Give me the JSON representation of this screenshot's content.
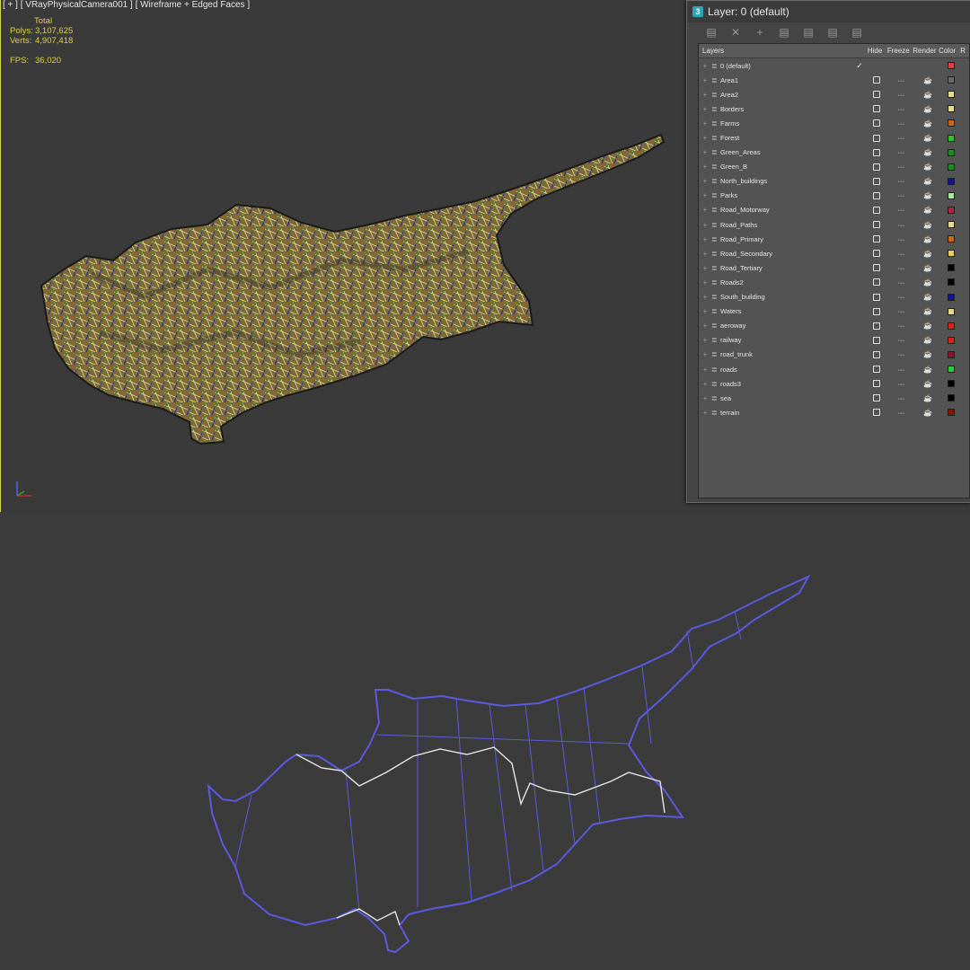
{
  "viewport": {
    "label": "[ + ] [ VRayPhysicalCamera001 ] [ Wireframe + Edged Faces ]",
    "stats": {
      "total_label": "Total",
      "polys_label": "Polys:",
      "polys_value": "3,107,625",
      "verts_label": "Verts:",
      "verts_value": "4,907,418",
      "fps_label": "FPS:",
      "fps_value": "36,020"
    }
  },
  "layer_window": {
    "title": "Layer: 0 (default)",
    "toolbar_icons": [
      "new-layer-icon",
      "delete-layer-icon",
      "add-to-layer-icon",
      "select-in-layer-icon",
      "highlight-layer-icon",
      "hide-all-icon",
      "freeze-all-icon"
    ],
    "columns": {
      "layers": "Layers",
      "hide": "Hide",
      "freeze": "Freeze",
      "render": "Render",
      "color": "Color",
      "more": "R"
    },
    "layers": [
      {
        "name": "0 (default)",
        "current": true,
        "color": "#e04040"
      },
      {
        "name": "Area1",
        "current": false,
        "color": "#6a6a6a"
      },
      {
        "name": "Area2",
        "current": false,
        "color": "#e8d890"
      },
      {
        "name": "Borders",
        "current": false,
        "color": "#e8d890"
      },
      {
        "name": "Farms",
        "current": false,
        "color": "#c86818"
      },
      {
        "name": "Forest",
        "current": false,
        "color": "#30c030"
      },
      {
        "name": "Green_Areas",
        "current": false,
        "color": "#208a20"
      },
      {
        "name": "Green_B",
        "current": false,
        "color": "#208a20"
      },
      {
        "name": "North_buildings",
        "current": false,
        "color": "#101880"
      },
      {
        "name": "Parks",
        "current": false,
        "color": "#a8e8a0"
      },
      {
        "name": "Road_Motorway",
        "current": false,
        "color": "#b02040"
      },
      {
        "name": "Road_Paths",
        "current": false,
        "color": "#e8d890"
      },
      {
        "name": "Road_Primary",
        "current": false,
        "color": "#c86818"
      },
      {
        "name": "Road_Secondary",
        "current": false,
        "color": "#e8d060"
      },
      {
        "name": "Road_Tertiary",
        "current": false,
        "color": "#000000"
      },
      {
        "name": "Roads2",
        "current": false,
        "color": "#000000"
      },
      {
        "name": "South_building",
        "current": false,
        "color": "#101880"
      },
      {
        "name": "Waters",
        "current": false,
        "color": "#e8d890"
      },
      {
        "name": "aeroway",
        "current": false,
        "color": "#e02020"
      },
      {
        "name": "railway",
        "current": false,
        "color": "#e02020"
      },
      {
        "name": "road_trunk",
        "current": false,
        "color": "#901030"
      },
      {
        "name": "roads",
        "current": false,
        "color": "#20d040"
      },
      {
        "name": "roads3",
        "current": false,
        "color": "#000000"
      },
      {
        "name": "sea",
        "current": false,
        "color": "#000000"
      },
      {
        "name": "terrain",
        "current": false,
        "color": "#8a1010"
      }
    ]
  }
}
